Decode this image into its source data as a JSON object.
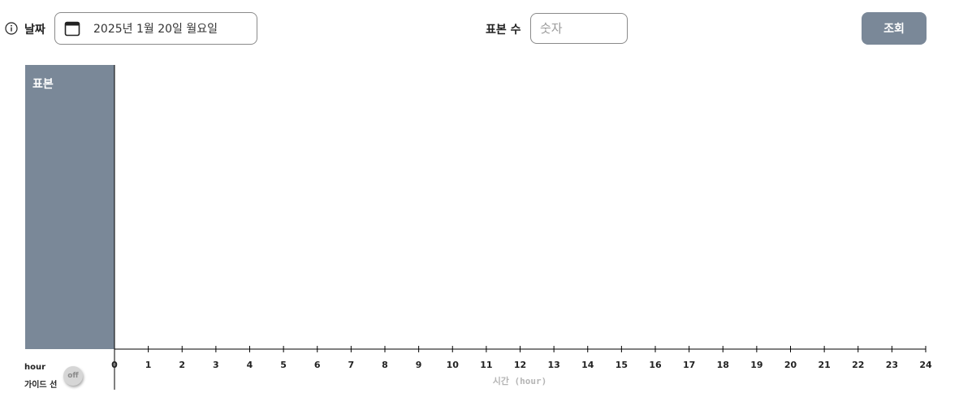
{
  "filters": {
    "date_label": "날짜",
    "date_value": "2025년 1월 20일 월요일",
    "sample_label": "표본 수",
    "sample_placeholder": "숫자",
    "query_label": "조회"
  },
  "panel": {
    "title": "표본",
    "color": "#7a8898"
  },
  "chart_data": {
    "type": "timeline",
    "xlabel": "시간 (hour)",
    "xlim": [
      0,
      24
    ],
    "ticks": [
      "0",
      "1",
      "2",
      "3",
      "4",
      "5",
      "6",
      "7",
      "8",
      "9",
      "10",
      "11",
      "12",
      "13",
      "14",
      "15",
      "16",
      "17",
      "18",
      "19",
      "20",
      "21",
      "22",
      "23",
      "24"
    ],
    "series": []
  },
  "footer": {
    "hour_label": "hour",
    "guide_label": "가이드 선",
    "guide_toggle": "off"
  },
  "icons": {
    "info": "info-icon",
    "calendar": "calendar-icon"
  }
}
